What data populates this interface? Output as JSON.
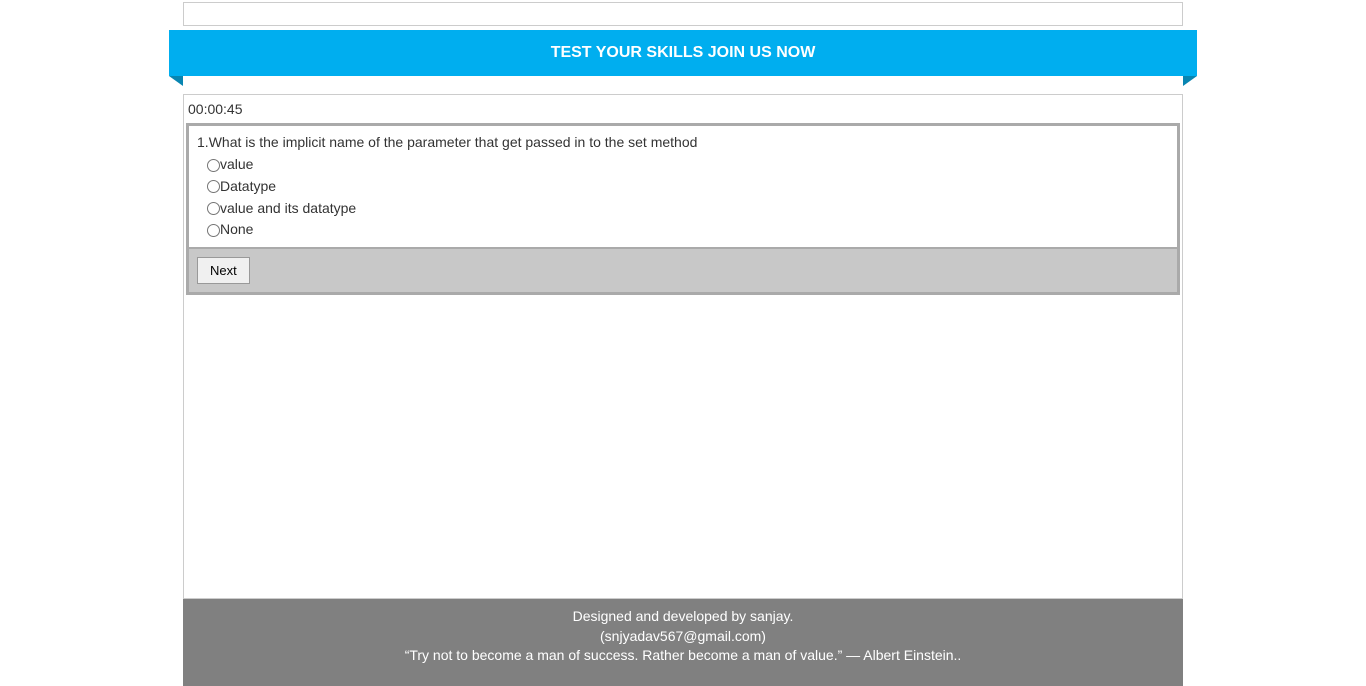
{
  "banner": {
    "text": "TEST YOUR SKILLS JOIN US NOW"
  },
  "timer": "00:00:45",
  "question": {
    "number_prefix": "1.",
    "text": "What is the implicit name of the parameter that get passed in to the set method",
    "options": [
      "value",
      "Datatype",
      "value and its datatype",
      "None"
    ]
  },
  "buttons": {
    "next": "Next"
  },
  "footer": {
    "line1": "Designed and developed by sanjay.",
    "line2": "(snjyadav567@gmail.com)",
    "line3": "“Try not to become a man of success. Rather become a man of value.” ― Albert Einstein.."
  }
}
